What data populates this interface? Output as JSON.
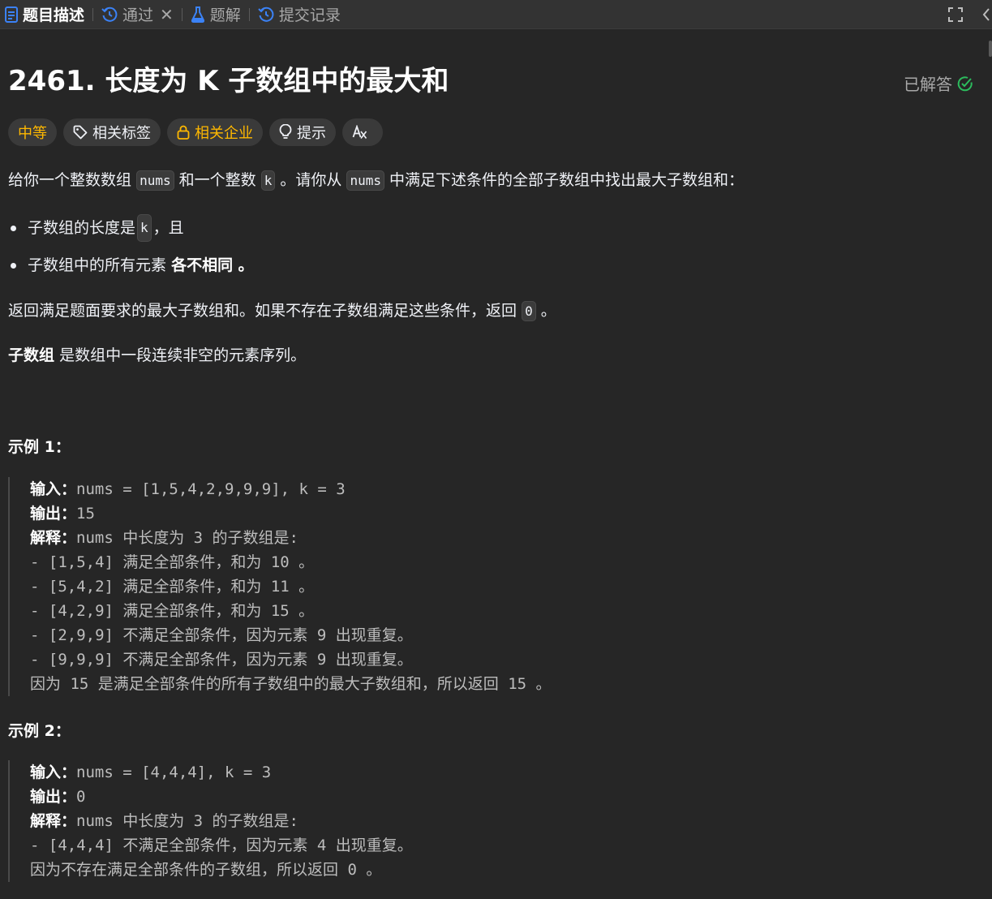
{
  "tabs": [
    {
      "label": "题目描述",
      "active": true
    },
    {
      "label": "通过",
      "active": false
    },
    {
      "label": "题解",
      "active": false
    },
    {
      "label": "提交记录",
      "active": false
    }
  ],
  "problem": {
    "title": "2461. 长度为 K 子数组中的最大和",
    "status": "已解答"
  },
  "tags": {
    "difficulty": "中等",
    "related_tags": "相关标签",
    "related_companies": "相关企业",
    "hint": "提示",
    "translate_icon": "translate-icon"
  },
  "desc": {
    "p1_a": "给你一个整数数组",
    "p1_code1": "nums",
    "p1_b": "和一个整数",
    "p1_code2": "k",
    "p1_c": "。请你从",
    "p1_code3": "nums",
    "p1_d": "中满足下述条件的全部子数组中找出最大子数组和：",
    "b1_a": "子数组的长度是",
    "b1_code": "k",
    "b1_b": "，且",
    "b2_a": "子数组中的所有元素",
    "b2_bold": "各不相同 。",
    "p2_a": "返回满足题面要求的最大子数组和。如果不存在子数组满足这些条件，返回",
    "p2_code": "0",
    "p2_b": "。",
    "p3_bold": "子数组",
    "p3_a": "是数组中一段连续非空的元素序列。"
  },
  "example1": {
    "title": "示例 1：",
    "input_label": "输入：",
    "input": "nums = [1,5,4,2,9,9,9], k = 3",
    "output_label": "输出：",
    "output": "15",
    "explain_label": "解释：",
    "explain": "nums 中长度为 3 的子数组是:",
    "lines": [
      "- [1,5,4] 满足全部条件，和为 10 。",
      "- [5,4,2] 满足全部条件，和为 11 。",
      "- [4,2,9] 满足全部条件，和为 15 。",
      "- [2,9,9] 不满足全部条件，因为元素 9 出现重复。",
      "- [9,9,9] 不满足全部条件，因为元素 9 出现重复。",
      "因为 15 是满足全部条件的所有子数组中的最大子数组和，所以返回 15 。"
    ]
  },
  "example2": {
    "title": "示例 2：",
    "input_label": "输入：",
    "input": "nums = [4,4,4], k = 3",
    "output_label": "输出：",
    "output": "0",
    "explain_label": "解释：",
    "explain": "nums 中长度为 3 的子数组是:",
    "lines": [
      "- [4,4,4] 不满足全部条件，因为元素 4 出现重复。",
      "因为不存在满足全部条件的子数组，所以返回 0 。"
    ]
  },
  "colors": {
    "accent_blue": "#3b82f6",
    "medium": "#ffb800",
    "solved_green": "#2cbb5d"
  }
}
